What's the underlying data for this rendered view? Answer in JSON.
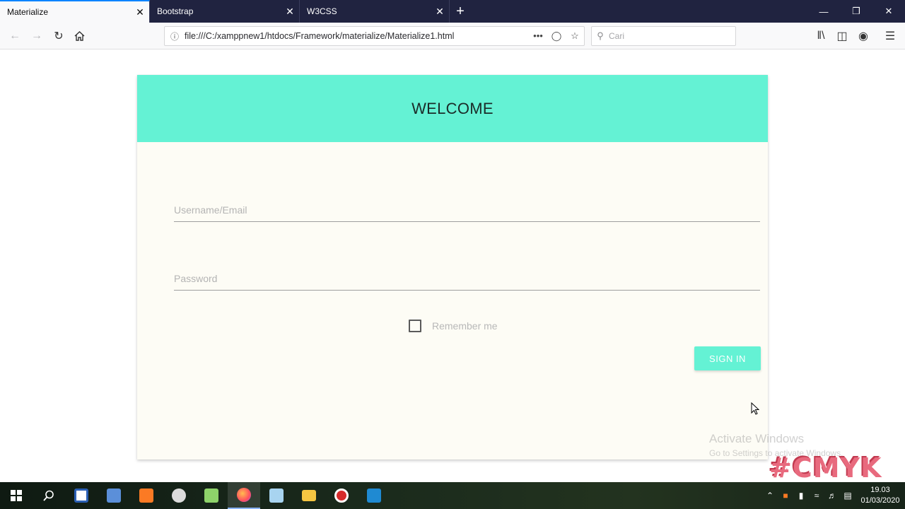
{
  "browser": {
    "tabs": [
      {
        "label": "Materialize",
        "active": true
      },
      {
        "label": "Bootstrap",
        "active": false
      },
      {
        "label": "W3CSS",
        "active": false
      }
    ],
    "url": "file:///C:/xamppnew1/htdocs/Framework/materialize/Materialize1.html",
    "search_placeholder": "Cari"
  },
  "page": {
    "title": "WELCOME",
    "username_placeholder": "Username/Email",
    "password_placeholder": "Password",
    "remember_label": "Remember me",
    "signin_label": "SIGN IN",
    "accent_color": "#64f2d4",
    "card_background": "#fdfcf5"
  },
  "overlay": {
    "activate_line1": "Activate Windows",
    "activate_line2": "Go to Settings to activate Windows.",
    "watermark": "#CMYK"
  },
  "taskbar": {
    "time": "19.03",
    "date": "01/03/2020",
    "apps": [
      "windows-start-icon",
      "search-icon",
      "store-icon",
      "box-icon",
      "xampp-icon",
      "paint-icon",
      "notepad-icon",
      "firefox-icon",
      "cube-icon",
      "file-explorer-icon",
      "recorder-icon",
      "vscode-icon"
    ]
  }
}
